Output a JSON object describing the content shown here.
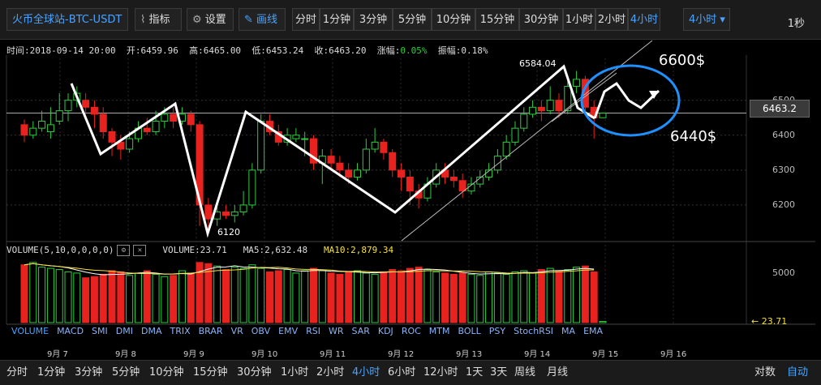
{
  "toolbar": {
    "symbol": "火币全球站-BTC-USDT",
    "indicators_label": "指标",
    "settings_label": "设置",
    "draw_label": "画线",
    "intervals": [
      "分时",
      "1分钟",
      "3分钟",
      "5分钟",
      "10分钟",
      "15分钟",
      "30分钟",
      "1小时",
      "2小时",
      "4小时"
    ],
    "dropdown_value": "4小时",
    "right_label": "1秒"
  },
  "info": {
    "time": "时间:2018-09-14 20:00",
    "open": "开:6459.96",
    "high": "高:6465.00",
    "low": "低:6453.24",
    "close": "收:6463.20",
    "change_label": "涨幅:",
    "change_value": "0.05%",
    "amplitude": "振幅:0.18%"
  },
  "price_axis": [
    "6500",
    "6400",
    "6300",
    "6200"
  ],
  "current_price": "6463.2",
  "annotations": {
    "peak_label": "6584.04",
    "trough_label": "6120",
    "target_high": "6600$",
    "target_low": "6440$"
  },
  "volume": {
    "title": "VOLUME(5,10,0,0,0,0)",
    "volume": "VOLUME:23.71",
    "ma5": "MA5:2,632.48",
    "ma10": "MA10:2,879.34",
    "axis": "5000",
    "current": "← 23.71"
  },
  "indicator_tabs": [
    "VOLUME",
    "MACD",
    "SMI",
    "DMI",
    "DMA",
    "TRIX",
    "BRAR",
    "VR",
    "OBV",
    "EMV",
    "RSI",
    "WR",
    "SAR",
    "KDJ",
    "ROC",
    "MTM",
    "BOLL",
    "PSY",
    "StochRSI",
    "MA",
    "EMA"
  ],
  "date_axis": [
    "9月 7",
    "9月 8",
    "9月 9",
    "9月 10",
    "9月 11",
    "9月 12",
    "9月 13",
    "9月 14",
    "9月 15",
    "9月 16"
  ],
  "bottom_bar": {
    "periods": [
      "分时",
      "1分钟",
      "3分钟",
      "5分钟",
      "10分钟",
      "15分钟",
      "30分钟",
      "1小时",
      "2小时",
      "4小时",
      "6小时",
      "12小时",
      "1天",
      "3天",
      "周线",
      "月线"
    ],
    "right_items": [
      "对数",
      "自动"
    ]
  },
  "colors": {
    "up": "#2ecc40",
    "down": "#e8231f",
    "accent": "#4aa3ff",
    "ellipse": "#1e90ff",
    "ma10": "#f5e13a"
  },
  "chart_data": {
    "type": "candlestick",
    "candles": [
      [
        6430,
        6400,
        6445,
        6380
      ],
      [
        6400,
        6420,
        6440,
        6390
      ],
      [
        6420,
        6440,
        6470,
        6410
      ],
      [
        6410,
        6430,
        6480,
        6390
      ],
      [
        6440,
        6470,
        6520,
        6430
      ],
      [
        6470,
        6500,
        6520,
        6440
      ],
      [
        6500,
        6520,
        6540,
        6480
      ],
      [
        6500,
        6480,
        6520,
        6460
      ],
      [
        6480,
        6460,
        6500,
        6420
      ],
      [
        6460,
        6410,
        6480,
        6390
      ],
      [
        6410,
        6380,
        6420,
        6340
      ],
      [
        6380,
        6360,
        6400,
        6330
      ],
      [
        6360,
        6390,
        6410,
        6350
      ],
      [
        6390,
        6420,
        6440,
        6380
      ],
      [
        6420,
        6410,
        6450,
        6400
      ],
      [
        6410,
        6440,
        6470,
        6400
      ],
      [
        6440,
        6460,
        6480,
        6420
      ],
      [
        6460,
        6440,
        6480,
        6420
      ],
      [
        6440,
        6460,
        6480,
        6430
      ],
      [
        6460,
        6430,
        6470,
        6410
      ],
      [
        6430,
        6200,
        6440,
        6140
      ],
      [
        6200,
        6160,
        6220,
        6130
      ],
      [
        6160,
        6180,
        6200,
        6140
      ],
      [
        6180,
        6170,
        6200,
        6160
      ],
      [
        6170,
        6180,
        6200,
        6150
      ],
      [
        6180,
        6200,
        6240,
        6170
      ],
      [
        6200,
        6300,
        6320,
        6190
      ],
      [
        6300,
        6440,
        6460,
        6290
      ],
      [
        6440,
        6410,
        6460,
        6400
      ],
      [
        6410,
        6380,
        6430,
        6370
      ],
      [
        6380,
        6400,
        6420,
        6370
      ],
      [
        6390,
        6400,
        6420,
        6380
      ],
      [
        6390,
        6390,
        6410,
        6340
      ],
      [
        6390,
        6320,
        6400,
        6300
      ],
      [
        6320,
        6340,
        6360,
        6260
      ],
      [
        6340,
        6320,
        6360,
        6300
      ],
      [
        6320,
        6300,
        6340,
        6280
      ],
      [
        6300,
        6280,
        6320,
        6260
      ],
      [
        6280,
        6300,
        6320,
        6270
      ],
      [
        6300,
        6360,
        6390,
        6290
      ],
      [
        6360,
        6380,
        6420,
        6350
      ],
      [
        6380,
        6350,
        6390,
        6330
      ],
      [
        6350,
        6300,
        6360,
        6280
      ],
      [
        6300,
        6280,
        6320,
        6240
      ],
      [
        6280,
        6240,
        6300,
        6200
      ],
      [
        6240,
        6220,
        6260,
        6190
      ],
      [
        6220,
        6260,
        6280,
        6210
      ],
      [
        6260,
        6300,
        6320,
        6250
      ],
      [
        6300,
        6280,
        6320,
        6260
      ],
      [
        6280,
        6270,
        6300,
        6250
      ],
      [
        6270,
        6240,
        6290,
        6220
      ],
      [
        6240,
        6260,
        6280,
        6230
      ],
      [
        6260,
        6280,
        6300,
        6250
      ],
      [
        6280,
        6300,
        6320,
        6270
      ],
      [
        6300,
        6340,
        6360,
        6290
      ],
      [
        6340,
        6380,
        6400,
        6330
      ],
      [
        6380,
        6420,
        6440,
        6370
      ],
      [
        6420,
        6460,
        6480,
        6410
      ],
      [
        6460,
        6480,
        6500,
        6450
      ],
      [
        6480,
        6470,
        6500,
        6440
      ],
      [
        6470,
        6500,
        6540,
        6460
      ],
      [
        6500,
        6470,
        6520,
        6450
      ],
      [
        6470,
        6540,
        6560,
        6460
      ],
      [
        6540,
        6560,
        6584,
        6520
      ],
      [
        6560,
        6480,
        6570,
        6460
      ],
      [
        6480,
        6450,
        6500,
        6390
      ],
      [
        6450,
        6463,
        6465,
        6453
      ]
    ],
    "volumes": [
      4900,
      5100,
      4700,
      4600,
      4500,
      4300,
      4200,
      3800,
      3900,
      4100,
      4400,
      4300,
      4000,
      4200,
      4400,
      4100,
      3900,
      4000,
      4400,
      4200,
      5100,
      5000,
      4800,
      4500,
      4700,
      4600,
      4900,
      4600,
      4300,
      4400,
      4500,
      4200,
      4400,
      4600,
      4400,
      4200,
      4100,
      4300,
      4400,
      4200,
      4100,
      4300,
      4500,
      4400,
      4600,
      4700,
      4500,
      4300,
      4200,
      4100,
      4200,
      4100,
      4000,
      4300,
      4200,
      4100,
      4300,
      4400,
      4200,
      4500,
      4600,
      4400,
      4500,
      4700,
      4800,
      4300,
      100
    ],
    "ylim": [
      6100,
      6620
    ],
    "vol_max": 5500
  }
}
